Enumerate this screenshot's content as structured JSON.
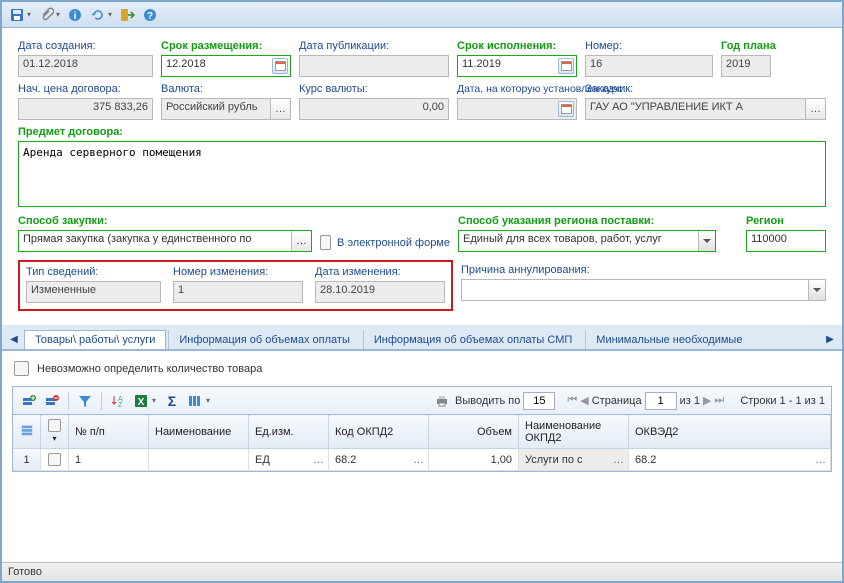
{
  "toolbar": {
    "drop": "▾"
  },
  "labels": {
    "date_created": "Дата создания:",
    "placement_deadline": "Срок размещения:",
    "date_published": "Дата публикации:",
    "execution_deadline": "Срок исполнения:",
    "number": "Номер:",
    "plan_year": "Год плана",
    "start_price": "Нач. цена договора:",
    "currency": "Валюта:",
    "exchange_rate": "Курс валюты:",
    "rate_date": "Дата, на которую установлен курс",
    "customer": "Заказчик:",
    "contract_subject": "Предмет договора:",
    "purchase_method": "Способ закупки:",
    "electronic_form": "В электронной форме",
    "region_method": "Способ указания региона поставки:",
    "region": "Регион",
    "info_type": "Тип сведений:",
    "change_number": "Номер изменения:",
    "change_date": "Дата изменения:",
    "cancel_reason": "Причина аннулирования:",
    "cannot_determine_qty": "Невозможно определить количество товара",
    "output_by": "Выводить по",
    "page": "Страница",
    "of": "из 1",
    "rows_info": "Строки 1 - 1 из 1"
  },
  "values": {
    "date_created": "01.12.2018",
    "placement_deadline": "12.2018",
    "execution_deadline": "11.2019",
    "number": "16",
    "plan_year": "2019",
    "start_price": "375 833,26",
    "currency": "Российский рубль",
    "exchange_rate": "0,00",
    "customer": "ГАУ АО \"УПРАВЛЕНИЕ ИКТ А",
    "contract_subject": "Аренда серверного помещения",
    "purchase_method": "Прямая закупка (закупка у единственного по",
    "region_method": "Единый для всех товаров, работ, услуг",
    "region": "110000",
    "info_type": "Измененные",
    "change_number": "1",
    "change_date": "28.10.2019",
    "page_size": "15",
    "page_num": "1"
  },
  "tabs": {
    "t1": "Товары\\ работы\\ услуги",
    "t2": "Информация об объемах оплаты",
    "t3": "Информация об объемах оплаты СМП",
    "t4": "Минимальные необходимые"
  },
  "grid": {
    "headers": {
      "num": "№ п/п",
      "name": "Наименование",
      "unit": "Ед.изм.",
      "okpd2": "Код ОКПД2",
      "volume": "Объем",
      "okpd2name": "Наименование ОКПД2",
      "okved2": "ОКВЭД2"
    },
    "row1": {
      "num": "1",
      "unit": "ЕД",
      "okpd2": "68.2",
      "volume": "1,00",
      "okpd2name": "Услуги по с",
      "okved2": "68.2"
    }
  },
  "status": "Готово"
}
